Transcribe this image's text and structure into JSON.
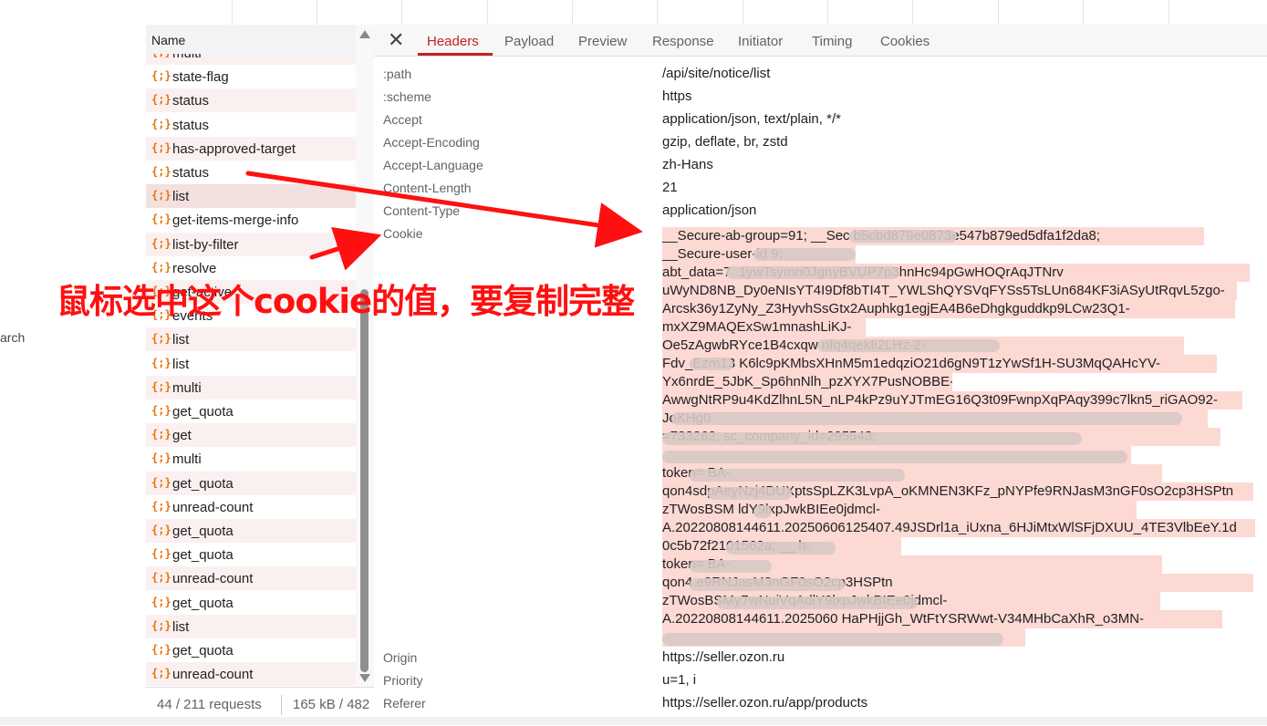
{
  "left_cut_text": "arch",
  "list": {
    "header": "Name",
    "rows": [
      {
        "icon": "{;}",
        "name": "multi"
      },
      {
        "icon": "{;}",
        "name": "state-flag"
      },
      {
        "icon": "{;}",
        "name": "status"
      },
      {
        "icon": "{;}",
        "name": "status"
      },
      {
        "icon": "{;}",
        "name": "has-approved-target"
      },
      {
        "icon": "{;}",
        "name": "status"
      },
      {
        "icon": "{;}",
        "name": "list"
      },
      {
        "icon": "{;}",
        "name": "get-items-merge-info"
      },
      {
        "icon": "{;}",
        "name": "list-by-filter"
      },
      {
        "icon": "{;}",
        "name": "resolve"
      },
      {
        "icon": "{;}",
        "name": "get-active"
      },
      {
        "icon": "{;}",
        "name": "events"
      },
      {
        "icon": "{;}",
        "name": "list"
      },
      {
        "icon": "{;}",
        "name": "list"
      },
      {
        "icon": "{;}",
        "name": "multi"
      },
      {
        "icon": "{;}",
        "name": "get_quota"
      },
      {
        "icon": "{;}",
        "name": "get"
      },
      {
        "icon": "{;}",
        "name": "multi"
      },
      {
        "icon": "{;}",
        "name": "get_quota"
      },
      {
        "icon": "{;}",
        "name": "unread-count"
      },
      {
        "icon": "{;}",
        "name": "get_quota"
      },
      {
        "icon": "{;}",
        "name": "get_quota"
      },
      {
        "icon": "{;}",
        "name": "unread-count"
      },
      {
        "icon": "{;}",
        "name": "get_quota"
      },
      {
        "icon": "{;}",
        "name": "list"
      },
      {
        "icon": "{;}",
        "name": "get_quota"
      },
      {
        "icon": "{;}",
        "name": "unread-count"
      }
    ],
    "selected_index": 6,
    "status": {
      "requests": "44 / 211 requests",
      "size": "165 kB / 482"
    }
  },
  "tabs": {
    "close": "✕",
    "items": [
      "Headers",
      "Payload",
      "Preview",
      "Response",
      "Initiator",
      "Timing",
      "Cookies"
    ],
    "active": "Headers"
  },
  "headers": [
    {
      "name": ":path",
      "value": "/api/site/notice/list"
    },
    {
      "name": ":scheme",
      "value": "https"
    },
    {
      "name": "Accept",
      "value": "application/json, text/plain, */*"
    },
    {
      "name": "Accept-Encoding",
      "value": "gzip, deflate, br, zstd"
    },
    {
      "name": "Accept-Language",
      "value": "zh-Hans"
    },
    {
      "name": "Content-Length",
      "value": "21"
    },
    {
      "name": "Content-Type",
      "value": "application/json"
    },
    {
      "name": "Cookie",
      "value": ""
    },
    {
      "name": "Origin",
      "value": "https://seller.ozon.ru"
    },
    {
      "name": "Priority",
      "value": "u=1, i"
    },
    {
      "name": "Referer",
      "value": "https://seller.ozon.ru/app/products"
    }
  ],
  "cookie_lines": [
    "__Secure-ab-group=91; __Sec                    b5cbd879e0873e547b879ed5dfa1f2da8;",
    "__Secure-user-id                    9;",
    "abt_data=7.              1ywTsymn0JgnyBVUP7p3hnHc94pGwHOQrAqJTNrv",
    "uWyND8NB_Dy0eNIsYT4I9Df8bTI4T_YWLShQYSVqFYSs5TsLUn684KF3iASyUtRqvL5zgo-",
    "Arcsk36y1ZyNy_Z3HyvhSsGtx2Auphkg1egjEA4B6eDhgkguddkp9LCw23Q1-",
    "mxXZ9MAQExSw1mnashLiKJ-",
    "Oe5zAgwbRYce1B4cxqw                                     nfq4qekIi2LHz-2-",
    "Fdv_Ezm13      K6lc9pKMbsXHnM5m1edqziO21d6gN9T1zYwSf1H-SU3MqQAHcYV-",
    "Yx6nrdE_5JbK_Sp6hnNlh_pzXYX7PusNOBBE-",
    "AwwgNtRP9u4KdZlhnL5N_nLP4kPz9uYJTmEG16Q3t09FwnpXqPAqy399c7lkn5_riGAO92-",
    "JoKHg0                                                            ",
    "                                              =733262; sc_company_id=295543;",
    "                                                                    ",
    "token=                                                        BA-",
    "qon4sdpAeyNzj4DUXptsSpLZK3LvpA_oKMNEN3KFz_pNYPfe9RNJasM3nGF0sO2cp3HSPtn",
    "zTWosBSM         ldY9lxpJwkBIEe0jdmcl-",
    "A.20220808144611.20250606125407.49JSDrl1a_iUxna_6HJiMtxWlSFjDXUU_4TE3VlbEeY.1d",
    "0c5b72f2101562a; __              h-",
    "token=                                                        BA-",
    "qon4                                             e9RNJasM3nGF0sO2cp3HSPtn",
    "zTWosBSMy7wNuiVqAdlY9lxpJwkBIEe0jdmcl-",
    "A.20220808144611.2025060               HaPHjjGh_WtFtYSRWwt-V34MHbCaXhR_o3MN-",
    "                                                     "
  ],
  "annotation": "鼠标选中这个cookie的值，要复制完整",
  "colors": {
    "accent_tab": "#c5221f",
    "selection_highlight": "#fcd9d2",
    "annotation_red": "#ff1010",
    "xhr_icon": "#e8710a"
  }
}
